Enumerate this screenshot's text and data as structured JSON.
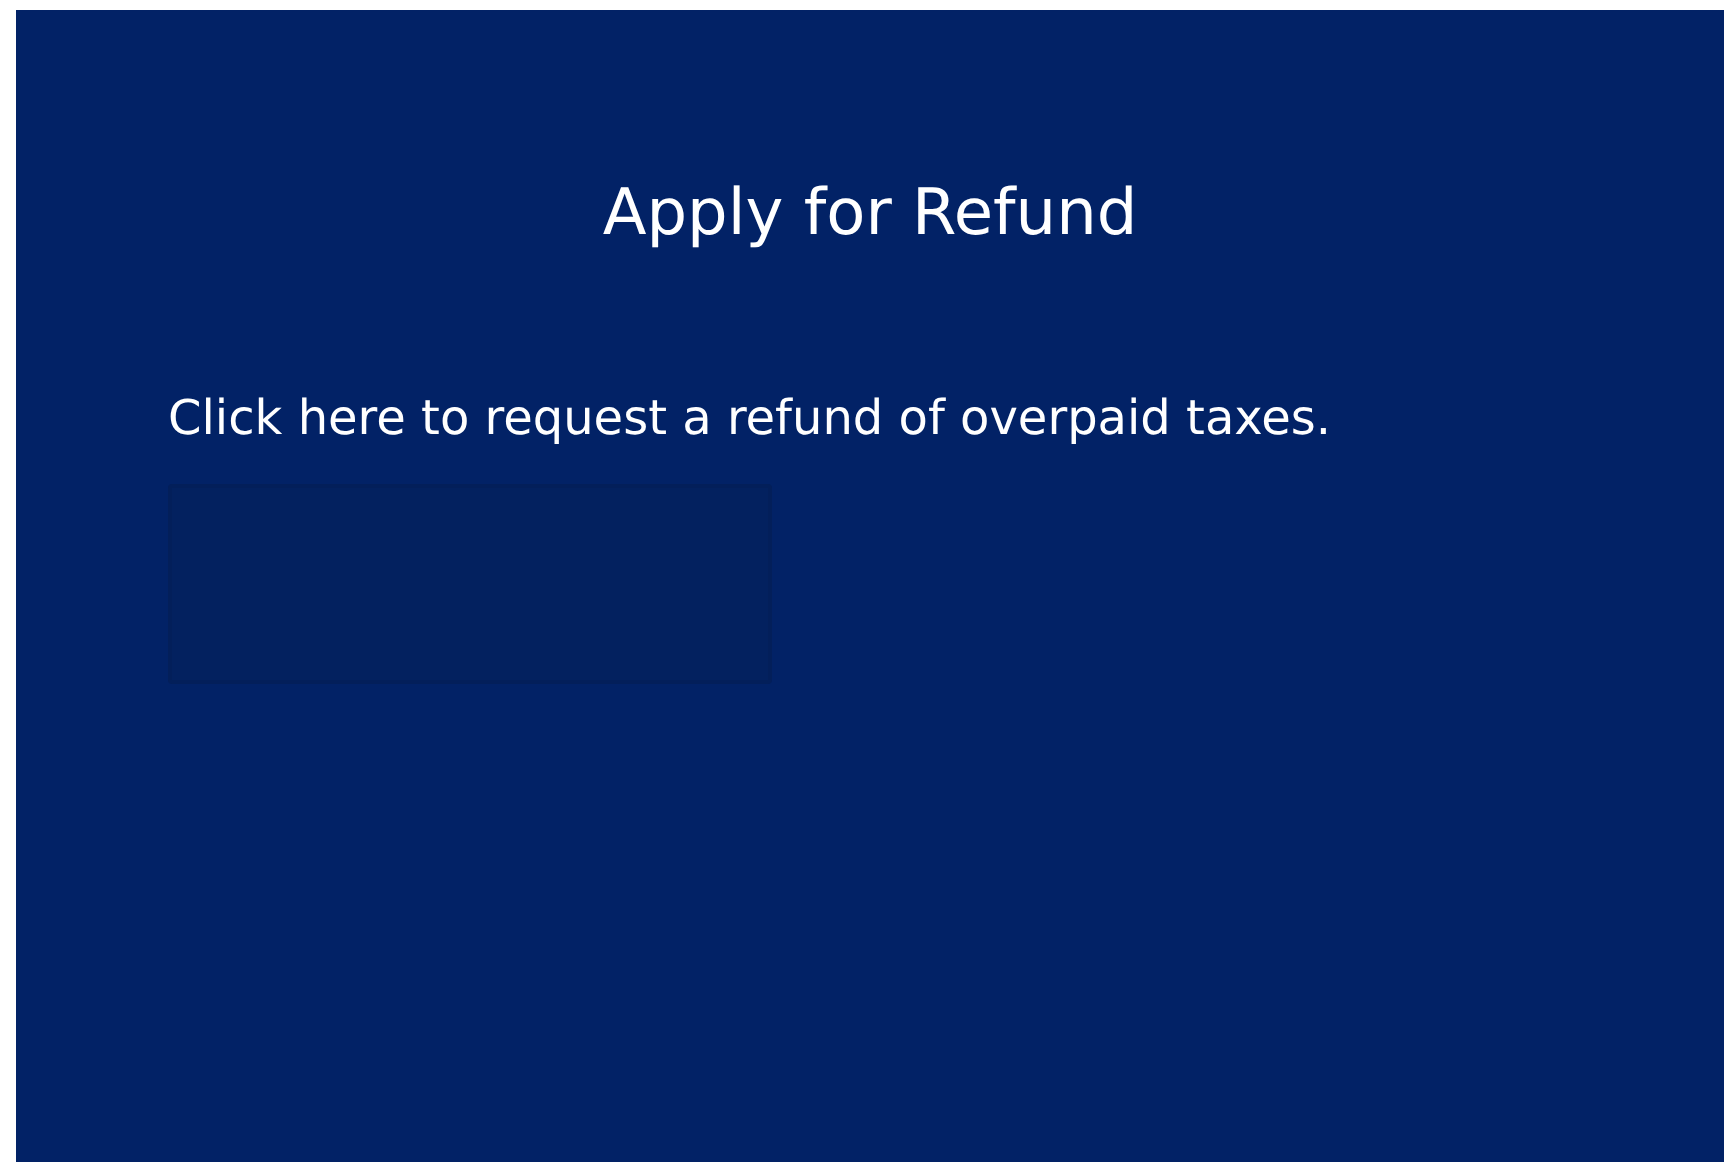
{
  "card": {
    "title": "Apply for Refund",
    "description": "Click here to request a refund of overpaid taxes."
  }
}
